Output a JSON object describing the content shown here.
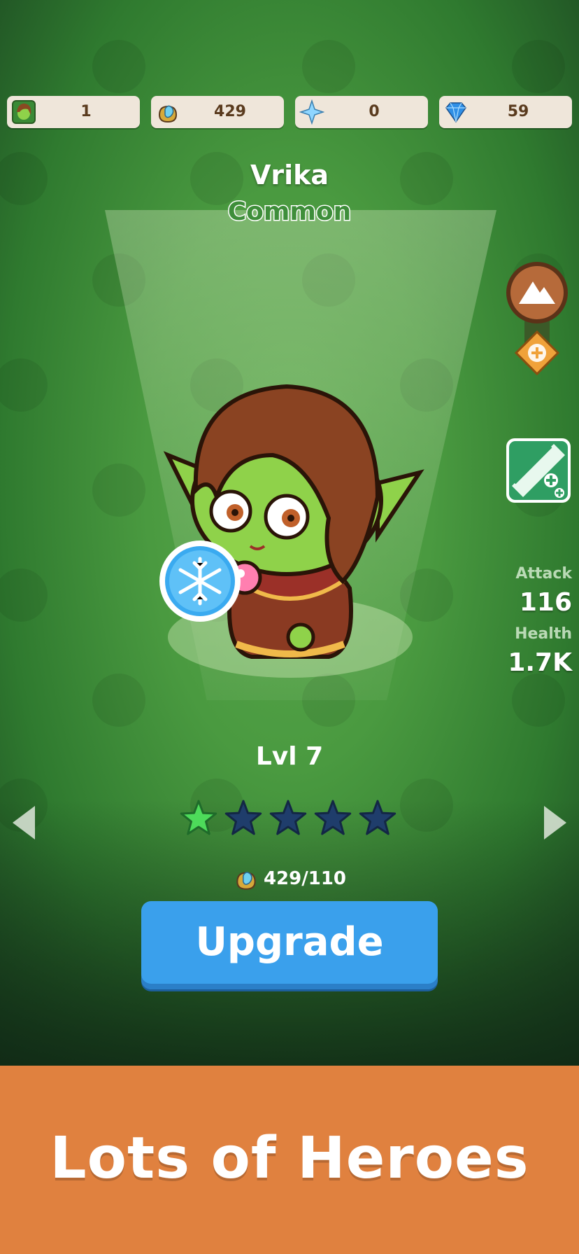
{
  "resources": [
    {
      "icon": "hero-portrait-icon",
      "value": "1"
    },
    {
      "icon": "gold-potion-icon",
      "value": "429"
    },
    {
      "icon": "sparkle-star-icon",
      "value": "0"
    },
    {
      "icon": "blue-gem-icon",
      "value": "59"
    }
  ],
  "hero": {
    "name": "Vrika",
    "rarity": "Common",
    "level_text": "Lvl 7",
    "stars_filled": 1,
    "stars_total": 5
  },
  "stats": {
    "attack_label": "Attack",
    "attack_value": "116",
    "health_label": "Health",
    "health_value": "1.7K"
  },
  "upgrade": {
    "cost_text": "429/110",
    "button_label": "Upgrade"
  },
  "banner": {
    "text": "Lots of Heroes"
  },
  "colors": {
    "background": "#4a9a40",
    "button": "#3aa0ec",
    "banner": "#e0813f",
    "star_filled": "#4ddb5a",
    "star_empty": "#1f3d6b"
  }
}
